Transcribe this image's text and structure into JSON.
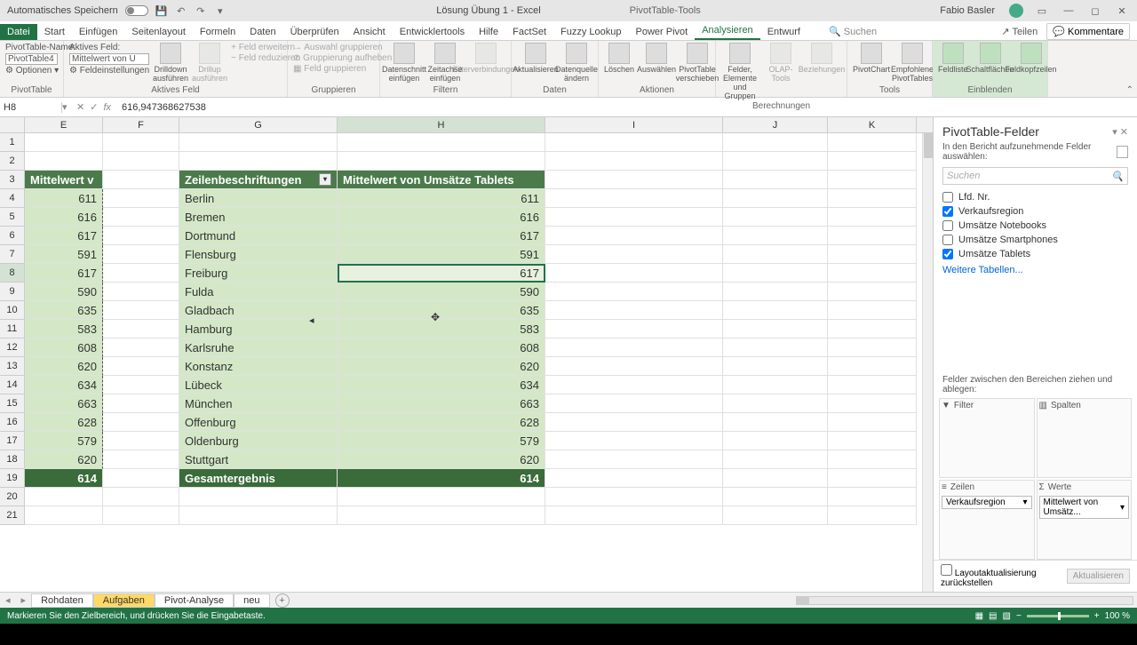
{
  "titlebar": {
    "autosave_label": "Automatisches Speichern",
    "doc_title": "Lösung Übung 1 - Excel",
    "tools_title": "PivotTable-Tools",
    "user_name": "Fabio Basler"
  },
  "tabs": {
    "file": "Datei",
    "list": [
      "Start",
      "Einfügen",
      "Seitenlayout",
      "Formeln",
      "Daten",
      "Überprüfen",
      "Ansicht",
      "Entwicklertools",
      "Hilfe",
      "FactSet",
      "Fuzzy Lookup",
      "Power Pivot",
      "Analysieren",
      "Entwurf"
    ],
    "active": "Analysieren",
    "search": "Suchen",
    "share": "Teilen",
    "comments": "Kommentare"
  },
  "ribbon": {
    "pt_name_label": "PivotTable-Name:",
    "pt_name_value": "PivotTable4",
    "pt_options": "Optionen",
    "group1_label": "PivotTable",
    "active_field_label": "Aktives Feld:",
    "active_field_value": "Mittelwert von U",
    "field_settings": "Feldeinstellungen",
    "drilldown": "Drilldown ausführen",
    "drillup": "Drillup ausführen",
    "expand": "Feld erweitern",
    "reduce": "Feld reduzieren",
    "group2_label": "Aktives Feld",
    "grp_sel": "Auswahl gruppieren",
    "grp_un": "Gruppierung aufheben",
    "grp_fld": "Feld gruppieren",
    "group3_label": "Gruppieren",
    "slicer": "Datenschnitt einfügen",
    "timeline": "Zeitachse einfügen",
    "filter_conn": "Filterverbindungen",
    "group4_label": "Filtern",
    "refresh": "Aktualisieren",
    "datasource": "Datenquelle ändern",
    "group5_label": "Daten",
    "clear": "Löschen",
    "select": "Auswählen",
    "move": "PivotTable verschieben",
    "group6_label": "Aktionen",
    "fields_items": "Felder, Elemente und Gruppen",
    "olap": "OLAP-Tools",
    "relations": "Beziehungen",
    "group7_label": "Berechnungen",
    "pivotchart": "PivotChart",
    "recommended": "Empfohlene PivotTables",
    "group8_label": "Tools",
    "fieldlist": "Feldliste",
    "buttons": "Schaltflächen",
    "headers": "Feldkopfzeilen",
    "group9_label": "Einblenden"
  },
  "formula": {
    "namebox": "H8",
    "value": "616,947368627538"
  },
  "columns": [
    "E",
    "F",
    "G",
    "H",
    "I",
    "J",
    "K"
  ],
  "pivot": {
    "col_e_header": "Mittelwert v",
    "row_label_header": "Zeilenbeschriftungen",
    "value_header": "Mittelwert von Umsätze Tablets",
    "total_label": "Gesamtergebnis",
    "total_value": "614",
    "rows": [
      {
        "city": "Berlin",
        "e": "611",
        "h": "611"
      },
      {
        "city": "Bremen",
        "e": "616",
        "h": "616"
      },
      {
        "city": "Dortmund",
        "e": "617",
        "h": "617"
      },
      {
        "city": "Flensburg",
        "e": "591",
        "h": "591"
      },
      {
        "city": "Freiburg",
        "e": "617",
        "h": "617"
      },
      {
        "city": "Fulda",
        "e": "590",
        "h": "590"
      },
      {
        "city": "Gladbach",
        "e": "635",
        "h": "635"
      },
      {
        "city": "Hamburg",
        "e": "583",
        "h": "583"
      },
      {
        "city": "Karlsruhe",
        "e": "608",
        "h": "608"
      },
      {
        "city": "Konstanz",
        "e": "620",
        "h": "620"
      },
      {
        "city": "Lübeck",
        "e": "634",
        "h": "634"
      },
      {
        "city": "München",
        "e": "663",
        "h": "663"
      },
      {
        "city": "Offenburg",
        "e": "628",
        "h": "628"
      },
      {
        "city": "Oldenburg",
        "e": "579",
        "h": "579"
      },
      {
        "city": "Stuttgart",
        "e": "620",
        "h": "620"
      }
    ],
    "e_total": "614"
  },
  "field_pane": {
    "title": "PivotTable-Felder",
    "subtitle": "In den Bericht aufzunehmende Felder auswählen:",
    "search_placeholder": "Suchen",
    "fields": [
      {
        "label": "Lfd. Nr.",
        "checked": false
      },
      {
        "label": "Verkaufsregion",
        "checked": true
      },
      {
        "label": "Umsätze Notebooks",
        "checked": false
      },
      {
        "label": "Umsätze Smartphones",
        "checked": false
      },
      {
        "label": "Umsätze Tablets",
        "checked": true
      }
    ],
    "more_tables": "Weitere Tabellen...",
    "drag_label": "Felder zwischen den Bereichen ziehen und ablegen:",
    "area_filter": "Filter",
    "area_columns": "Spalten",
    "area_rows": "Zeilen",
    "area_values": "Werte",
    "rows_chip": "Verkaufsregion",
    "values_chip": "Mittelwert von Umsätz...",
    "defer_label": "Layoutaktualisierung zurückstellen",
    "update_btn": "Aktualisieren"
  },
  "sheets": {
    "list": [
      "Rohdaten",
      "Aufgaben",
      "Pivot-Analyse",
      "neu"
    ],
    "active": "Aufgaben"
  },
  "status": {
    "message": "Markieren Sie den Zielbereich, und drücken Sie die Eingabetaste.",
    "zoom": "100 %"
  }
}
